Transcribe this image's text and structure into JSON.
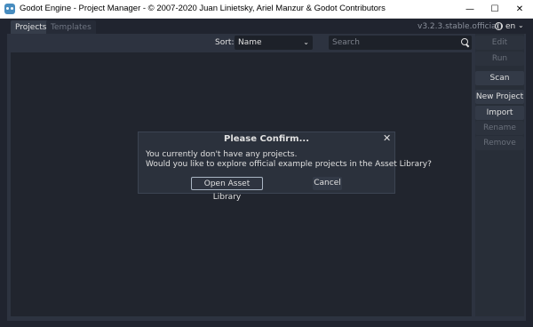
{
  "window": {
    "title": "Godot Engine - Project Manager - © 2007-2020 Juan Linietsky, Ariel Manzur & Godot Contributors",
    "controls": {
      "minimize": "—",
      "maximize": "☐",
      "close": "✕"
    }
  },
  "tabs": [
    {
      "label": "Projects",
      "active": true
    },
    {
      "label": "Templates",
      "active": false
    }
  ],
  "version": "v3.2.3.stable.official",
  "language": {
    "code": "en",
    "chevron": "⌄"
  },
  "toolbar": {
    "sort_label": "Sort:",
    "sort_value": "Name",
    "sort_chevron": "⌄",
    "search_placeholder": "Search"
  },
  "side_buttons": [
    {
      "label": "Edit",
      "enabled": false
    },
    {
      "label": "Run",
      "enabled": false
    },
    {
      "label": "Scan",
      "enabled": true
    },
    {
      "label": "New Project",
      "enabled": true
    },
    {
      "label": "Import",
      "enabled": true
    },
    {
      "label": "Rename",
      "enabled": false
    },
    {
      "label": "Remove",
      "enabled": false
    }
  ],
  "dialog": {
    "title": "Please Confirm...",
    "close": "✕",
    "message_line1": "You currently don't have any projects.",
    "message_line2": "Would you like to explore official example projects in the Asset Library?",
    "ok_label": "Open Asset Library",
    "cancel_label": "Cancel"
  },
  "colors": {
    "background": "#20242f",
    "panel": "#2d3340",
    "list": "#21252e",
    "accent_icon": "#478cbf"
  }
}
